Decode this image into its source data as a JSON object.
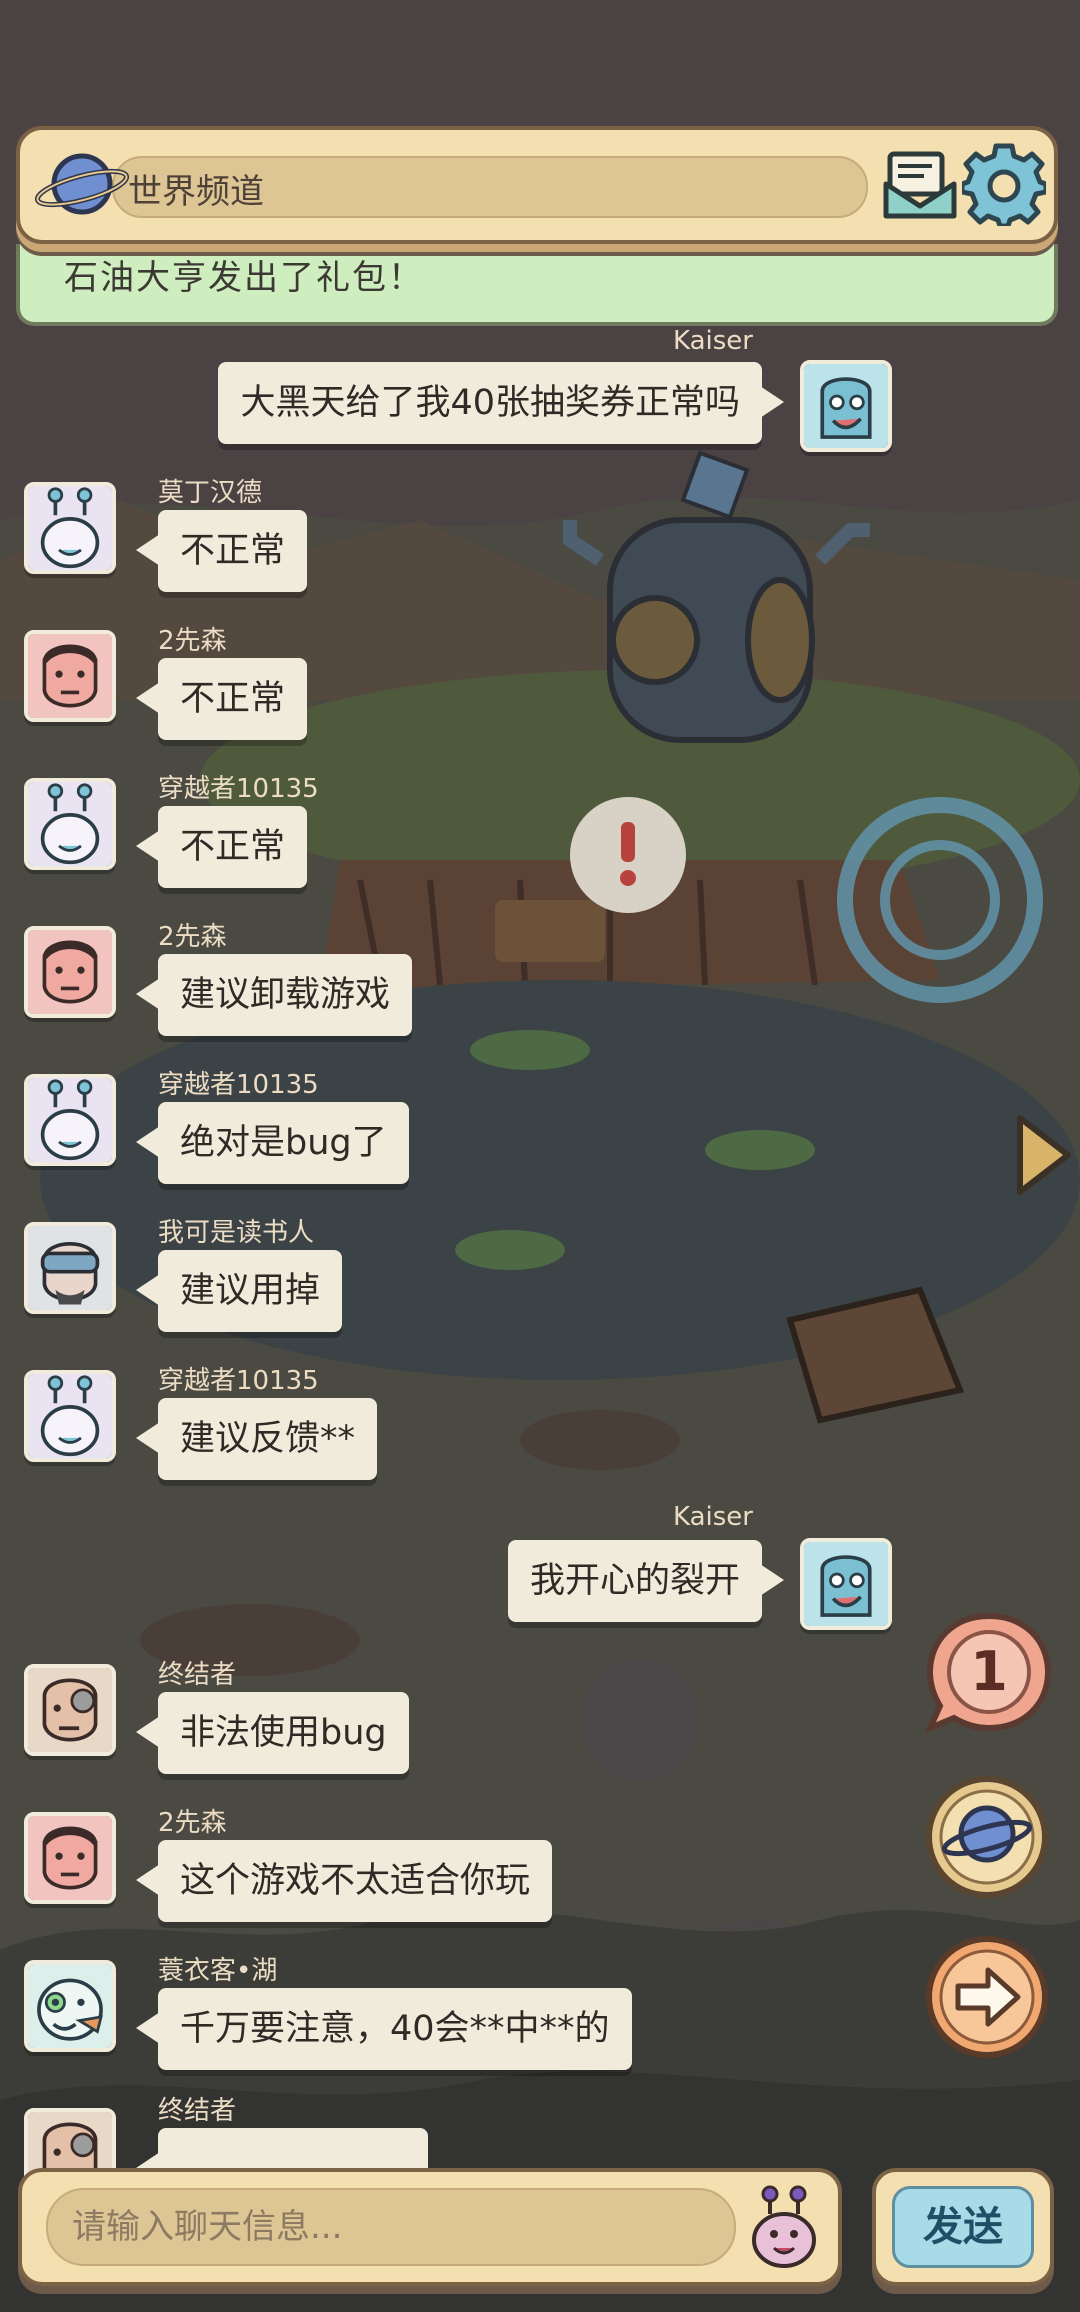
{
  "header": {
    "channel_name": "世界频道",
    "system_message": "石油大亨发出了礼包！"
  },
  "messages": [
    {
      "side": "right",
      "name": "Kaiser",
      "text": "大黑天给了我40张抽奖券正常吗",
      "avatar_icon": "pharaoh-mask-avatar"
    },
    {
      "side": "left",
      "name": "莫丁汉德",
      "text": "不正常",
      "avatar_icon": "snail-alien-avatar"
    },
    {
      "side": "left",
      "name": "2先森",
      "text": "不正常",
      "avatar_icon": "man-face-avatar"
    },
    {
      "side": "left",
      "name": "穿越者10135",
      "text": "不正常",
      "avatar_icon": "snail-alien-avatar"
    },
    {
      "side": "left",
      "name": "2先森",
      "text": "建议卸载游戏",
      "avatar_icon": "man-face-avatar"
    },
    {
      "side": "left",
      "name": "穿越者10135",
      "text": "绝对是bug了",
      "avatar_icon": "snail-alien-avatar"
    },
    {
      "side": "left",
      "name": "我可是读书人",
      "text": "建议用掉",
      "avatar_icon": "goggles-man-avatar"
    },
    {
      "side": "left",
      "name": "穿越者10135",
      "text": "建议反馈**",
      "avatar_icon": "snail-alien-avatar"
    },
    {
      "side": "right",
      "name": "Kaiser",
      "text": "我开心的裂开",
      "avatar_icon": "pharaoh-mask-avatar"
    },
    {
      "side": "left",
      "name": "终结者",
      "text": "非法使用bug",
      "avatar_icon": "cyborg-face-avatar"
    },
    {
      "side": "left",
      "name": "2先森",
      "text": "这个游戏不太适合你玩",
      "avatar_icon": "man-face-avatar"
    },
    {
      "side": "left",
      "name": "蓑衣客•湖",
      "text": "千万要注意，40会**中**的",
      "avatar_icon": "green-eyed-creature-avatar"
    },
    {
      "side": "left",
      "name": "终结者",
      "text": "",
      "avatar_icon": "cyborg-face-avatar"
    }
  ],
  "side_buttons": {
    "unread_count": "1"
  },
  "input": {
    "placeholder": "请输入聊天信息...",
    "value": ""
  },
  "send": {
    "label": "发送"
  },
  "colors": {
    "panel": "#f3dfb0",
    "panel_border": "#7b6244",
    "bubble": "#f1ebdc",
    "system_strip": "#cfeec0",
    "send_button": "#a8dbe8"
  }
}
